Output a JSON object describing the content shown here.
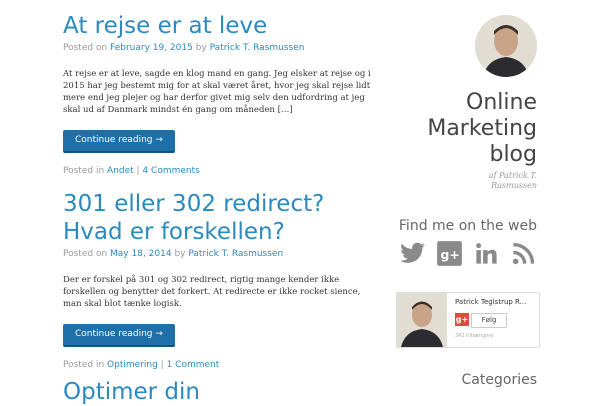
{
  "posts": [
    {
      "title": "At rejse er at leve",
      "posted_on": "Posted on",
      "date": "February 19, 2015",
      "by": "by",
      "author": "Patrick T. Rasmussen",
      "excerpt": "At rejse er at leve, sagde en klog mand en gang. Jeg elsker at rejse og i 2015 har jeg bestemt mig for at skal været året, hvor jeg skal rejse lidt mere end jeg plejer og har derfor givet mig selv den udfordring at jeg skal ud af Danmark mindst én gang om måneden […]",
      "button": "Continue reading →",
      "posted_in": "Posted in",
      "category": "Andet",
      "separator": "|",
      "comments": "4 Comments"
    },
    {
      "title": "301 eller 302 redirect? Hvad er forskellen?",
      "posted_on": "Posted on",
      "date": "May 18, 2014",
      "by": "by",
      "author": "Patrick T. Rasmussen",
      "excerpt": "Der er forskel på 301 og 302 redirect, rigtig mange kender ikke forskellen og benytter det forkert. At redirecte er ikke rocket sience, man skal blot tænke logisk.",
      "button": "Continue reading →",
      "posted_in": "Posted in",
      "category": "Optimering",
      "separator": "|",
      "comments": "1 Comment"
    },
    {
      "title": "Optimer din"
    }
  ],
  "sidebar": {
    "blog_title": "Online Marketing blog",
    "blog_subtitle": "af Patrick T. Rasmussen",
    "find_heading": "Find me on the web",
    "social_icons": [
      "twitter-icon",
      "google-plus-icon",
      "linkedin-icon",
      "rss-icon"
    ],
    "gplus_box": {
      "name": "Patrick Teglstrup R...",
      "g_label": "g+",
      "follow": "Følg",
      "followers": "342 tilhængere"
    },
    "categories_heading": "Categories"
  },
  "colors": {
    "link": "#2a8ac0",
    "button": "#1f6fa8",
    "icon": "#8a8a8a"
  }
}
